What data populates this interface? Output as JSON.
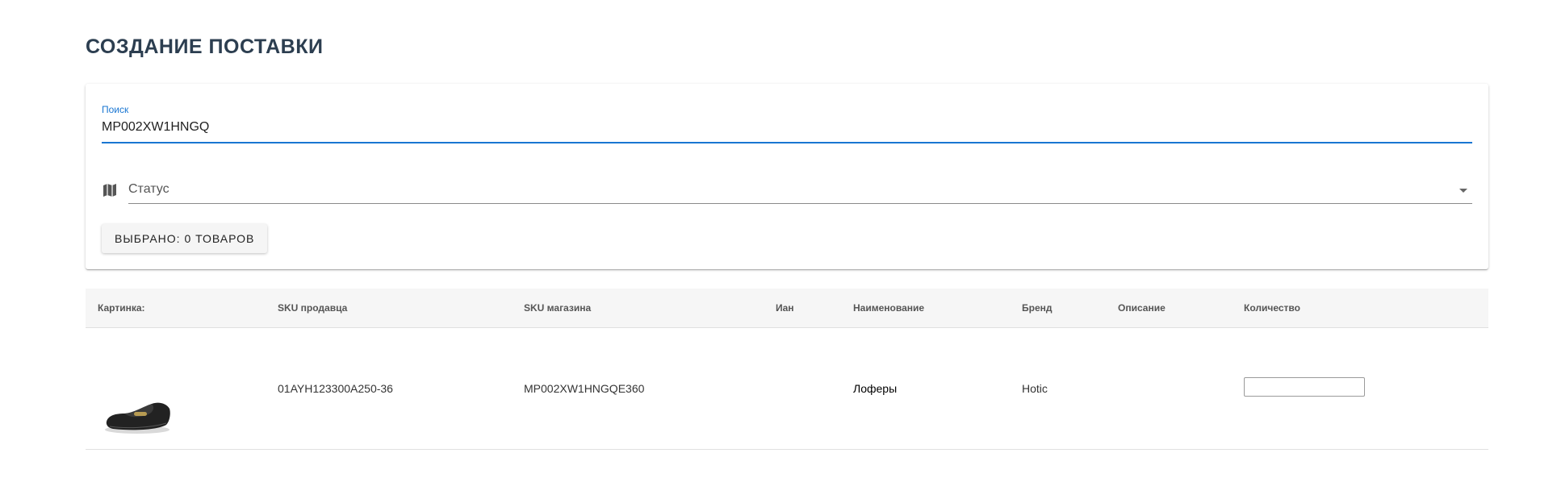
{
  "page": {
    "title": "СОЗДАНИЕ ПОСТАВКИ"
  },
  "search": {
    "label": "Поиск",
    "value": "MP002XW1HNGQ"
  },
  "status": {
    "placeholder": "Статус",
    "icon": "map-icon"
  },
  "selection": {
    "button_label": "ВЫБРАНО: 0 ТОВАРОВ"
  },
  "accent_color": "#1976d2",
  "table": {
    "columns": {
      "image": "Картинка:",
      "seller_sku": "SKU продавца",
      "shop_sku": "SKU магазина",
      "ean": "Иан",
      "name": "Наименование",
      "brand": "Бренд",
      "description": "Описание",
      "quantity": "Количество"
    },
    "rows": [
      {
        "image": "loafer-shoe",
        "seller_sku": "01AYH123300A250-36",
        "shop_sku": "MP002XW1HNGQE360",
        "ean": "",
        "name": "Лоферы",
        "brand": "Hotic",
        "description": "",
        "quantity": ""
      }
    ]
  }
}
